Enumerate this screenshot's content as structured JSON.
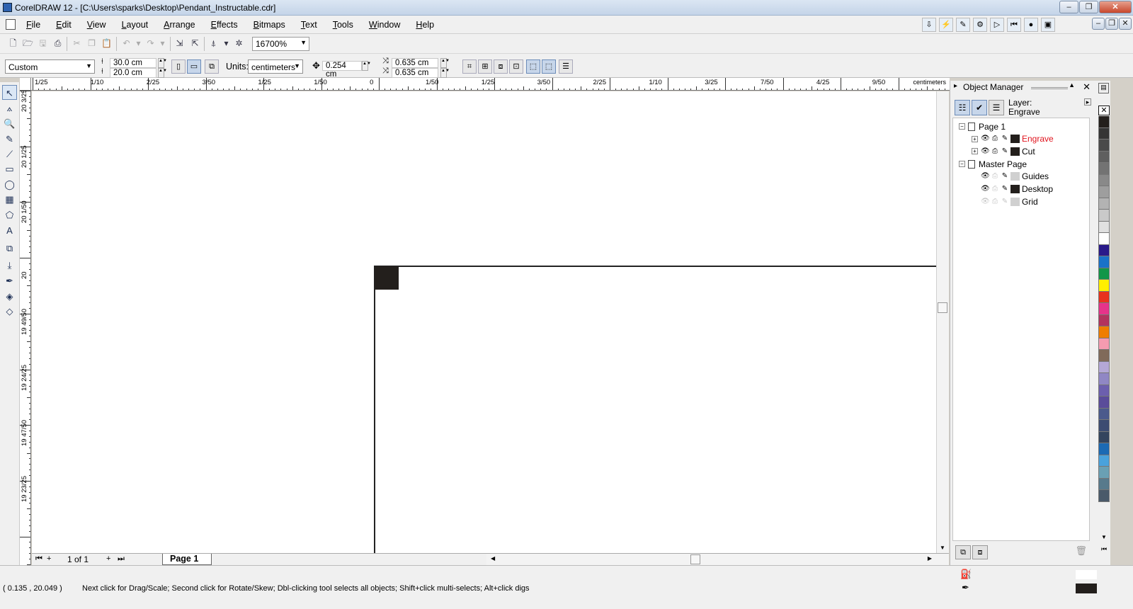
{
  "window": {
    "title": "CorelDRAW 12 - [C:\\Users\\sparks\\Desktop\\Pendant_Instructable.cdr]",
    "minimize": "–",
    "restore": "❐",
    "close": "✕"
  },
  "menu": {
    "items": [
      "File",
      "Edit",
      "View",
      "Layout",
      "Arrange",
      "Effects",
      "Bitmaps",
      "Text",
      "Tools",
      "Window",
      "Help"
    ]
  },
  "standard_toolbar": {
    "zoom_level": "16700%"
  },
  "property_bar": {
    "paper_preset": "Custom",
    "page_width": "30.0 cm",
    "page_height": "20.0 cm",
    "units_label": "Units:",
    "units_value": "centimeters",
    "nudge_distance": "0.254 cm",
    "duplicate_x": "0.635 cm",
    "duplicate_y": "0.635 cm"
  },
  "rulers": {
    "horizontal_labels": [
      "1/25",
      "1/10",
      "2/25",
      "3/50",
      "1/25",
      "1/50",
      "0",
      "1/50",
      "1/25",
      "3/50",
      "2/25",
      "1/10",
      "3/25",
      "7/50",
      "4/25",
      "9/50"
    ],
    "horizontal_unit": "centimeters",
    "vertical_labels": [
      "20 3/25",
      "20 1/25",
      "20 1/50",
      "20",
      "19 49/50",
      "19 24/25",
      "19 47/50",
      "19 23/25"
    ],
    "vertical_unit": "centimeters"
  },
  "page_nav": {
    "counter": "1 of 1",
    "tab_label": "Page 1"
  },
  "object_manager": {
    "title": "Object Manager",
    "layer_label": "Layer:",
    "layer_name": "Engrave",
    "tree": [
      {
        "label": "Page 1",
        "type": "page"
      },
      {
        "label": "Engrave",
        "type": "layer",
        "color": "#231f1c",
        "active": true
      },
      {
        "label": "Cut",
        "type": "layer",
        "color": "#231f1c",
        "active": false
      },
      {
        "label": "Master Page",
        "type": "page"
      },
      {
        "label": "Guides",
        "type": "master-layer",
        "color": "#d0d0d0"
      },
      {
        "label": "Desktop",
        "type": "master-layer",
        "color": "#231f1c"
      },
      {
        "label": "Grid",
        "type": "master-layer",
        "color": "#d0d0d0"
      }
    ]
  },
  "palette": {
    "colors": [
      "#231f1c",
      "#353535",
      "#4a4a4a",
      "#5f5f5f",
      "#737373",
      "#898989",
      "#9e9e9e",
      "#b3b3b3",
      "#c9c9c9",
      "#e0e0e0",
      "#ffffff",
      "#2a1a8a",
      "#1a72c8",
      "#139648",
      "#ffef00",
      "#e8321e",
      "#e6338a",
      "#b3335e",
      "#ef7d00",
      "#f59bb0",
      "#806a5a",
      "#b4a8d6",
      "#9087c4",
      "#6c5fae",
      "#5a4c9a",
      "#4b5a8c",
      "#3c4c72",
      "#33445e",
      "#1c6ab4",
      "#4aa2dc",
      "#6aa0b4",
      "#587a8c",
      "#4a5a6a"
    ]
  },
  "status": {
    "coordinates": "( 0.135 , 20.049 )",
    "message": "Next click for Drag/Scale; Second click for Rotate/Skew; Dbl-clicking tool selects all objects; Shift+click multi-selects; Alt+click digs",
    "fill_color": "#ffffff",
    "outline_color": "#231f1c"
  }
}
